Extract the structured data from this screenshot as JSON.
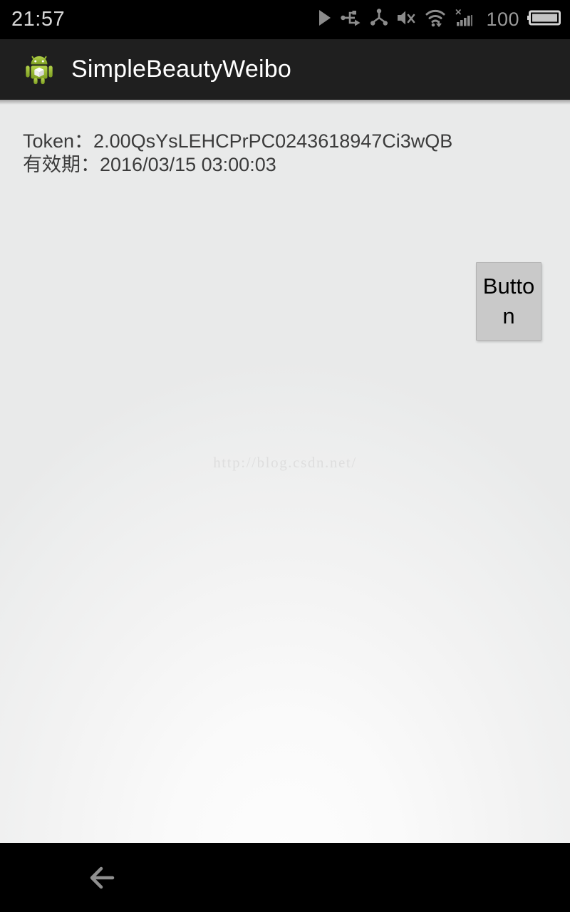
{
  "status_bar": {
    "time": "21:57",
    "battery_percent": "100",
    "icons": [
      "play-icon",
      "usb-icon",
      "share-nodes-icon",
      "volume-mute-icon",
      "wifi-download-icon",
      "cellular-signal-no-service-icon",
      "battery-icon"
    ],
    "colors": {
      "background": "#000000",
      "text": "#d8d8d8",
      "icon": "#8c8c8c"
    }
  },
  "action_bar": {
    "title": "SimpleBeautyWeibo",
    "icon": "android-robot-icon",
    "colors": {
      "background": "#1f1f1f",
      "title": "#ffffff",
      "robot_green": "#a4c639"
    }
  },
  "content": {
    "token_line": "Token：2.00QsYsLEHCPrPC0243618947Ci3wQB",
    "expiry_line": "有效期：2016/03/15 03:00:03",
    "button_label": "Button",
    "watermark": "http://blog.csdn.net/",
    "colors": {
      "text": "#3b3b3b",
      "button_face": "#c9c9c9",
      "button_text": "#000000",
      "watermark": "#dedede",
      "background": "#f2f2f2"
    }
  },
  "nav_bar": {
    "back_icon": "arrow-left-icon",
    "colors": {
      "background": "#000000",
      "icon": "#8f8f8f"
    }
  }
}
